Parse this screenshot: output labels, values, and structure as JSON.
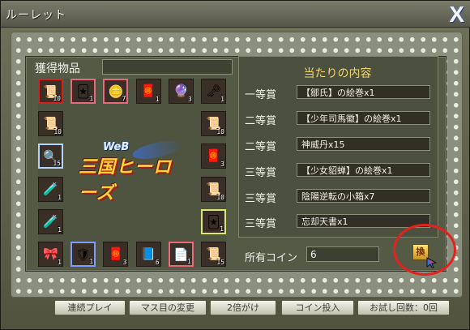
{
  "window": {
    "title": "ルーレット",
    "close_label": "X"
  },
  "left": {
    "acquired_label": "獲得物品",
    "acquired_value": ""
  },
  "logo": {
    "web": "WeB",
    "main": "三国ヒーローズ"
  },
  "board": {
    "cells": [
      {
        "icon": "scroll-icon",
        "glyph": "📜",
        "count": "10",
        "border": "#d92020"
      },
      {
        "icon": "card-icon",
        "glyph": "🃏",
        "count": "1",
        "border": "#e86a7a"
      },
      {
        "icon": "gold-chest-icon",
        "glyph": "🪙",
        "count": "7",
        "border": "#e86a7a"
      },
      {
        "icon": "talisman-icon",
        "glyph": "🧧",
        "count": "1",
        "border": "#1f1a13"
      },
      {
        "icon": "orb-icon",
        "glyph": "🔮",
        "count": "3",
        "border": "#1f1a13"
      },
      {
        "icon": "key-icon",
        "glyph": "🗝",
        "count": "1",
        "border": "#1f1a13"
      },
      {
        "icon": "scroll-icon",
        "glyph": "📜",
        "count": "10",
        "border": "#1f1a13"
      },
      {
        "icon": "scroll-icon",
        "glyph": "📜",
        "count": "10",
        "border": "#1f1a13"
      },
      {
        "icon": "magnifier-icon",
        "glyph": "🔍",
        "count": "15",
        "border": "#b6d3ff"
      },
      {
        "icon": "talisman-icon",
        "glyph": "🧧",
        "count": "3",
        "border": "#1f1a13"
      },
      {
        "icon": "potion-icon",
        "glyph": "🧪",
        "count": "1",
        "border": "#1f1a13"
      },
      {
        "icon": "scroll-icon",
        "glyph": "📜",
        "count": "10",
        "border": "#1f1a13"
      },
      {
        "icon": "potion-icon",
        "glyph": "🧪",
        "count": "1",
        "border": "#1f1a13"
      },
      {
        "icon": "card-icon",
        "glyph": "🃏",
        "count": "1",
        "border": "#d8e874"
      },
      {
        "icon": "ribbon-icon",
        "glyph": "🎀",
        "count": "1",
        "border": "#1f1a13"
      },
      {
        "icon": "shield-card-icon",
        "glyph": "🛡",
        "count": "1",
        "border": "#7f9cff"
      },
      {
        "icon": "talisman-icon",
        "glyph": "🧧",
        "count": "3",
        "border": "#1f1a13"
      },
      {
        "icon": "book-icon",
        "glyph": "📘",
        "count": "6",
        "border": "#1f1a13"
      },
      {
        "icon": "paper-icon",
        "glyph": "📄",
        "count": "1",
        "border": "#e86a7a"
      },
      {
        "icon": "scroll-icon",
        "glyph": "📜",
        "count": "15",
        "border": "#1f1a13"
      }
    ]
  },
  "prizes": {
    "title": "当たりの内容",
    "items": [
      {
        "rank": "一等賞",
        "value": "【鄒氏】の絵巻x1"
      },
      {
        "rank": "二等賞",
        "value": "【少年司馬徽】の絵巻x1"
      },
      {
        "rank": "二等賞",
        "value": "神威丹x15"
      },
      {
        "rank": "三等賞",
        "value": "【少女貂蝉】の絵巻x1"
      },
      {
        "rank": "三等賞",
        "value": "陰陽逆転の小箱x7"
      },
      {
        "rank": "三等賞",
        "value": "忘却天書x1"
      }
    ]
  },
  "coins": {
    "label": "所有コイン",
    "value": "6",
    "exchange_label": "換"
  },
  "buttons": {
    "continuous": "連続プレイ",
    "change": "マス目の変更",
    "double": "2倍がけ",
    "insert": "コイン投入",
    "trial": "お試し回数：0回"
  }
}
